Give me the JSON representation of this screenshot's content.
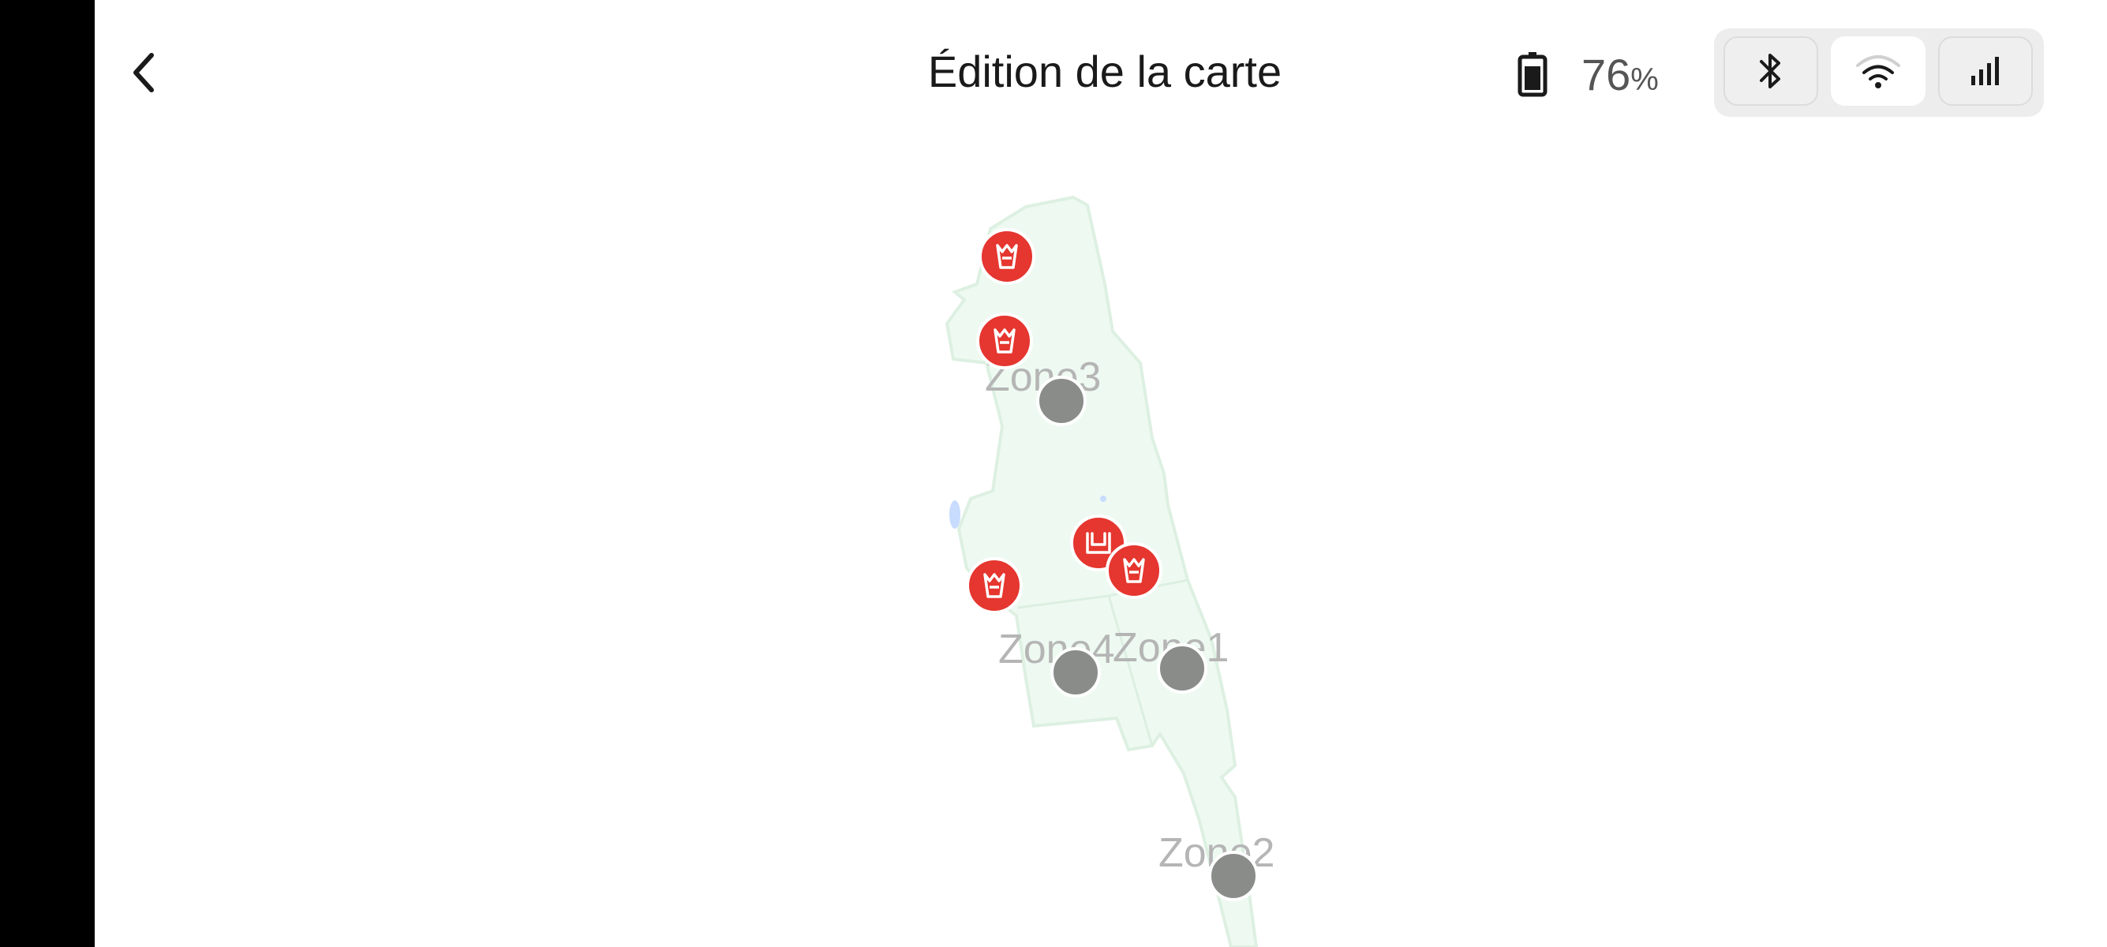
{
  "header": {
    "title": "Édition de la carte",
    "back_icon": "chevron-left-icon"
  },
  "status": {
    "battery_value": "76",
    "battery_unit": "%",
    "battery_icon": "battery-icon"
  },
  "connection": {
    "options": [
      {
        "icon": "bluetooth-icon",
        "active": false
      },
      {
        "icon": "wifi-icon",
        "active": true
      },
      {
        "icon": "cellular-signal-icon",
        "active": false
      }
    ]
  },
  "map": {
    "zones": [
      {
        "label": "Zone3"
      },
      {
        "label": "Zone4"
      },
      {
        "label": "Zone1"
      },
      {
        "label": "Zone2"
      }
    ],
    "markers": [
      {
        "icon": "tree-obstacle-icon"
      },
      {
        "icon": "tree-obstacle-icon"
      },
      {
        "icon": "charging-station-icon"
      },
      {
        "icon": "tree-obstacle-icon"
      },
      {
        "icon": "tree-obstacle-icon"
      }
    ],
    "colors": {
      "lawn": "#eefaf1",
      "lawn_border": "#ddf0e2",
      "marker": "#e5362f",
      "zone_handle": "#8a8c8a"
    }
  }
}
